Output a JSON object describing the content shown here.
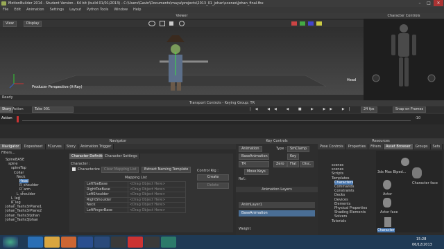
{
  "window": {
    "title": "MotionBuilder 2014 - Student Version  - 64 bit (build 01/01/2013) - C:\\Users\\Gavin\\Documents\\maya\\projects\\2013_01_johan\\scenes\\Johan_final.fbx"
  },
  "menu": [
    "File",
    "Edit",
    "Animation",
    "Settings",
    "Layout",
    "Python Tools",
    "Window",
    "Help"
  ],
  "viewer": {
    "title": "Viewer",
    "view_label": "View",
    "display_label": "Display",
    "perspective_label": "Producer Perspective (X-Ray)",
    "head_label": "Head",
    "status": "Ready"
  },
  "character_controls": {
    "title": "Character Controls"
  },
  "transport": {
    "title": "Transport Controls  -  Keying Group: TR",
    "story_tab": "Story",
    "action_tab": "Action",
    "take_label": "Take 001",
    "fps": "24 fps",
    "snap": "Snap on Frames",
    "action_label": "Action",
    "start": "0",
    "end": "-10"
  },
  "navigator": {
    "title": "Navigator",
    "tabs": [
      "Navigator",
      "Dopesheet",
      "FCurves",
      "Story",
      "Animation Trigger"
    ],
    "filters": "Filters...",
    "tree": [
      "SpineBASE",
      "spine",
      "spineTop",
      "Collar",
      "Neck",
      "Head",
      "R_shoulder",
      "R_arm",
      "L_shoulder",
      "L_leg",
      "R_leg",
      "Johan_Tashs3rPlane1",
      "Johan_Tashs3rPlane2",
      "Johan_Tashs3rJohan",
      "Johan_Tashs3Johan"
    ],
    "char_tabs": [
      "Character Definition",
      "Character Settings"
    ],
    "character_label": "Character :",
    "characterize_label": "Characterize",
    "clear_label": "Clear Mapping List",
    "extract_label": "Extract Naming Template",
    "mapping_title": "Mapping List",
    "mapping": [
      {
        "name": "LeftToeBase",
        "value": "<Drag Object Here>"
      },
      {
        "name": "RightToeBase",
        "value": "<Drag Object Here>"
      },
      {
        "name": "LeftShoulder",
        "value": "<Drag Object Here>"
      },
      {
        "name": "RightShoulder",
        "value": "<Drag Object Here>"
      },
      {
        "name": "Neck",
        "value": "<Drag Object Here>"
      },
      {
        "name": "LeftFingerBase",
        "value": "<Drag Object Here>"
      }
    ],
    "control_rig_label": "Control Rig :",
    "create_label": "Create",
    "delete_label": "Delete"
  },
  "key_controls": {
    "title": "Key Controls",
    "animation_label": "Animation",
    "type_label": "Type :",
    "type_value": "SmClamp",
    "base_animation": "BaseAnimation",
    "key_label": "Key",
    "tr_label": "TR",
    "zero_label": "Zero",
    "flat_label": "Flat",
    "disc_label": "Disc.",
    "move_keys": "Move Keys",
    "ref_label": "Ref.:",
    "layers_title": "Animation Layers",
    "layers": [
      "AnimLayer1",
      "BaseAnimation"
    ],
    "weight_label": "Weight"
  },
  "resources": {
    "title": "Resources",
    "tabs": [
      "Pose Controls",
      "Properties",
      "Filters",
      "Asset Browser",
      "Groups",
      "Sets"
    ],
    "folders": [
      "scenes",
      "scenes",
      "Scripts",
      "Templates",
      "Characters",
      "Commands",
      "Constraints",
      "Decks",
      "Devices",
      "Elements",
      "Physical Properties",
      "Shading Elements",
      "Solvers",
      "Tutorials"
    ],
    "assets": [
      "3ds Max Biped...",
      "Character face",
      "Actor",
      "Actor face",
      "Character"
    ]
  },
  "taskbar": {
    "time": "15:28",
    "date": "06/12/2013"
  }
}
